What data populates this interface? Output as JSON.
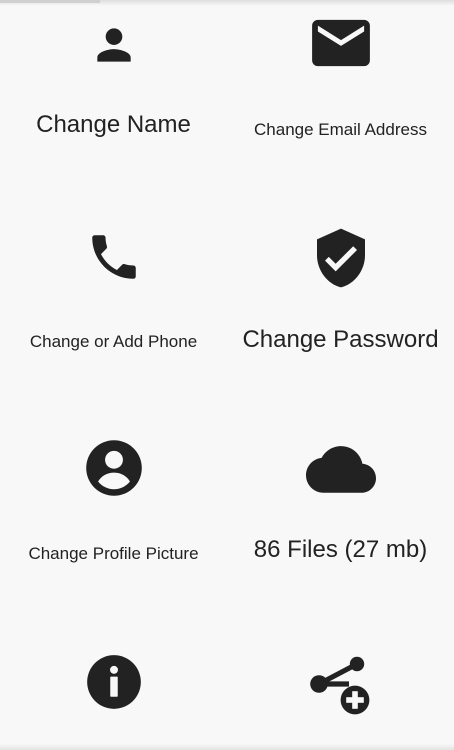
{
  "actions": [
    {
      "label": "Change Name",
      "icon": "person-icon"
    },
    {
      "label": "Change Email Address",
      "icon": "email-icon"
    },
    {
      "label": "Change or Add Phone",
      "icon": "phone-icon"
    },
    {
      "label": "Change Password",
      "icon": "shield-check-icon"
    },
    {
      "label": "Change Profile Picture",
      "icon": "account-circle-icon"
    },
    {
      "label": "86 Files (27 mb)",
      "icon": "cloud-icon"
    },
    {
      "label": "",
      "icon": "info-icon"
    },
    {
      "label": "",
      "icon": "share-add-icon"
    }
  ],
  "colors": {
    "background": "#f8f8f8",
    "icon": "#222222",
    "text": "#222222"
  }
}
